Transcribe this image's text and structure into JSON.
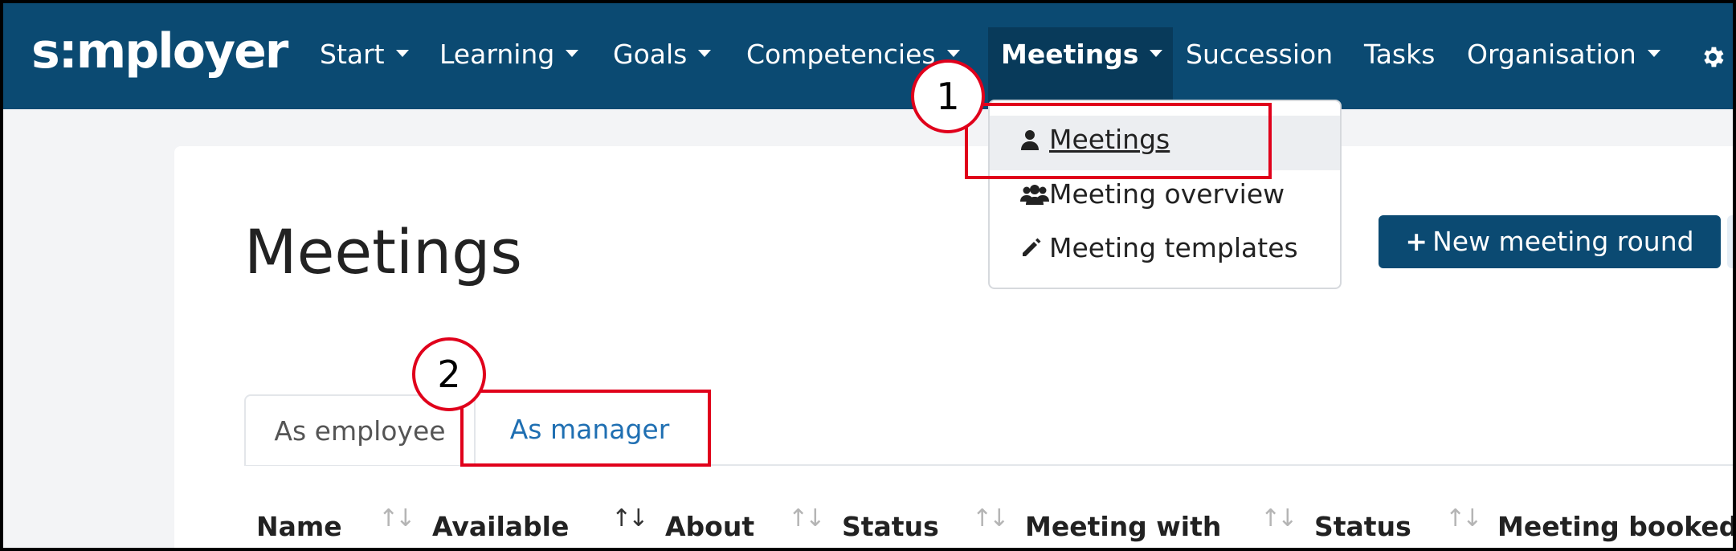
{
  "brand": {
    "name": "s:mployer"
  },
  "nav": {
    "items": [
      {
        "label": "Start",
        "has_caret": true
      },
      {
        "label": "Learning",
        "has_caret": true
      },
      {
        "label": "Goals",
        "has_caret": true
      },
      {
        "label": "Competencies",
        "has_caret": true
      },
      {
        "label": "Meetings",
        "has_caret": true,
        "active": true
      },
      {
        "label": "Succession",
        "has_caret": false
      },
      {
        "label": "Tasks",
        "has_caret": false
      },
      {
        "label": "Organisation",
        "has_caret": true
      }
    ],
    "settings_icon": "gear-icon"
  },
  "dropdown": {
    "items": [
      {
        "label": "Meetings",
        "icon": "user-icon",
        "hovered": true
      },
      {
        "label": "Meeting overview",
        "icon": "users-icon"
      },
      {
        "label": "Meeting templates",
        "icon": "pencil-icon"
      }
    ]
  },
  "page": {
    "title": "Meetings",
    "new_round_button": "New meeting round"
  },
  "tabs": [
    {
      "label": "As employee",
      "active": true
    },
    {
      "label": "As manager",
      "active": false
    }
  ],
  "table": {
    "columns": [
      "Name",
      "Available",
      "About",
      "Status",
      "Meeting with",
      "Status",
      "Meeting booked"
    ]
  },
  "callouts": [
    {
      "number": "1",
      "target": "Meetings menu item"
    },
    {
      "number": "2",
      "target": "As manager tab"
    }
  ],
  "colors": {
    "nav_background": "#0b4a72",
    "nav_active": "#083a5a",
    "button_primary": "#0b4a72",
    "tab_link": "#1f6fb2",
    "callout_red": "#e0001b"
  }
}
